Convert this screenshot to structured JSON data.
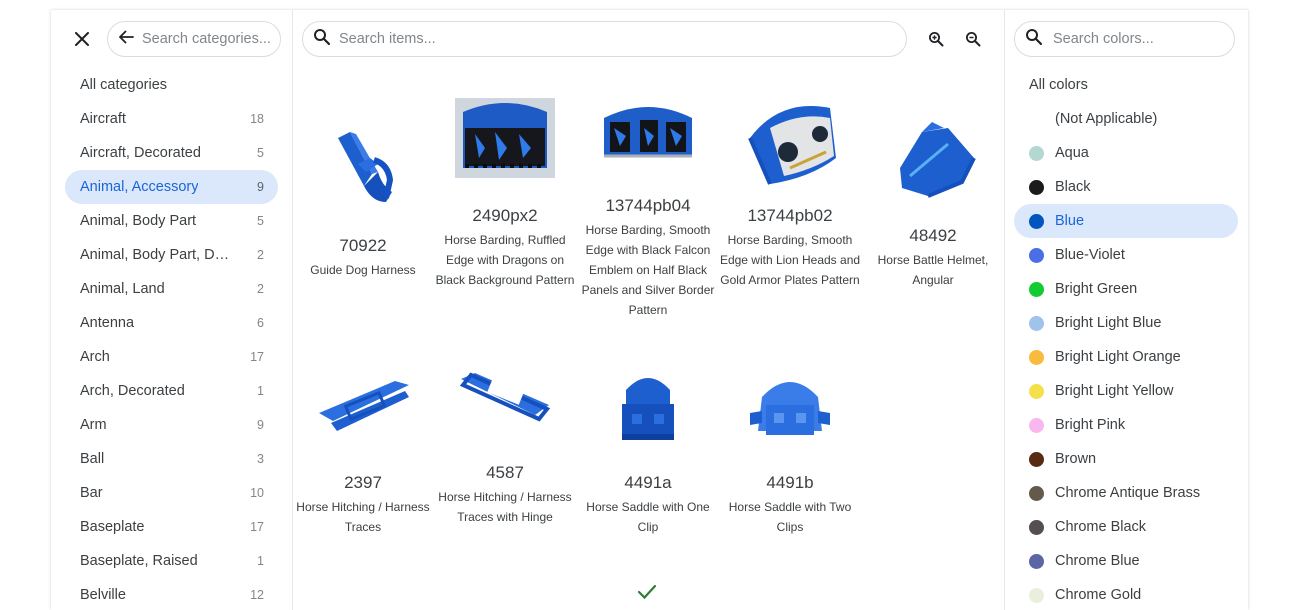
{
  "categories_panel": {
    "search_placeholder": "Search categories...",
    "items": [
      {
        "label": "All categories",
        "count": ""
      },
      {
        "label": "Aircraft",
        "count": "18"
      },
      {
        "label": "Aircraft, Decorated",
        "count": "5"
      },
      {
        "label": "Animal, Accessory",
        "count": "9",
        "active": true
      },
      {
        "label": "Animal, Body Part",
        "count": "5"
      },
      {
        "label": "Animal, Body Part, Dec...",
        "count": "2"
      },
      {
        "label": "Animal, Land",
        "count": "2"
      },
      {
        "label": "Antenna",
        "count": "6"
      },
      {
        "label": "Arch",
        "count": "17"
      },
      {
        "label": "Arch, Decorated",
        "count": "1"
      },
      {
        "label": "Arm",
        "count": "9"
      },
      {
        "label": "Ball",
        "count": "3"
      },
      {
        "label": "Bar",
        "count": "10"
      },
      {
        "label": "Baseplate",
        "count": "17"
      },
      {
        "label": "Baseplate, Raised",
        "count": "1"
      },
      {
        "label": "Belville",
        "count": "12"
      }
    ]
  },
  "items_panel": {
    "search_placeholder": "Search items...",
    "parts": [
      {
        "id": "70922",
        "name": "Guide Dog Harness"
      },
      {
        "id": "2490px2",
        "name": "Horse Barding, Ruffled Edge with Dragons on Black Background Pattern"
      },
      {
        "id": "13744pb04",
        "name": "Horse Barding, Smooth Edge with Black Falcon Emblem on Half Black Panels and Silver Border Pattern"
      },
      {
        "id": "13744pb02",
        "name": "Horse Barding, Smooth Edge with Lion Heads and Gold Armor Plates Pattern"
      },
      {
        "id": "48492",
        "name": "Horse Battle Helmet, Angular"
      },
      {
        "id": "2397",
        "name": "Horse Hitching / Harness Traces"
      },
      {
        "id": "4587",
        "name": "Horse Hitching / Harness Traces with Hinge"
      },
      {
        "id": "4491a",
        "name": "Horse Saddle with One Clip"
      },
      {
        "id": "4491b",
        "name": "Horse Saddle with Two Clips"
      }
    ]
  },
  "colors_panel": {
    "search_placeholder": "Search colors...",
    "items": [
      {
        "label": "All colors",
        "color": ""
      },
      {
        "label": "(Not Applicable)",
        "color": ""
      },
      {
        "label": "Aqua",
        "color": "#b3d7d1"
      },
      {
        "label": "Black",
        "color": "#1b1b1b"
      },
      {
        "label": "Blue",
        "color": "#0055bf",
        "active": true
      },
      {
        "label": "Blue-Violet",
        "color": "#4a6ee5"
      },
      {
        "label": "Bright Green",
        "color": "#10cb31"
      },
      {
        "label": "Bright Light Blue",
        "color": "#9fc3e9"
      },
      {
        "label": "Bright Light Orange",
        "color": "#f8bb3d"
      },
      {
        "label": "Bright Light Yellow",
        "color": "#f3e04a"
      },
      {
        "label": "Bright Pink",
        "color": "#f9b7f0"
      },
      {
        "label": "Brown",
        "color": "#582a12"
      },
      {
        "label": "Chrome Antique Brass",
        "color": "#645a4c"
      },
      {
        "label": "Chrome Black",
        "color": "#544e4f"
      },
      {
        "label": "Chrome Blue",
        "color": "#5c66a4"
      },
      {
        "label": "Chrome Gold",
        "color": "#e9efdc"
      }
    ]
  },
  "accent": "#1a66d6",
  "selection_bg": "#dbe7fb"
}
